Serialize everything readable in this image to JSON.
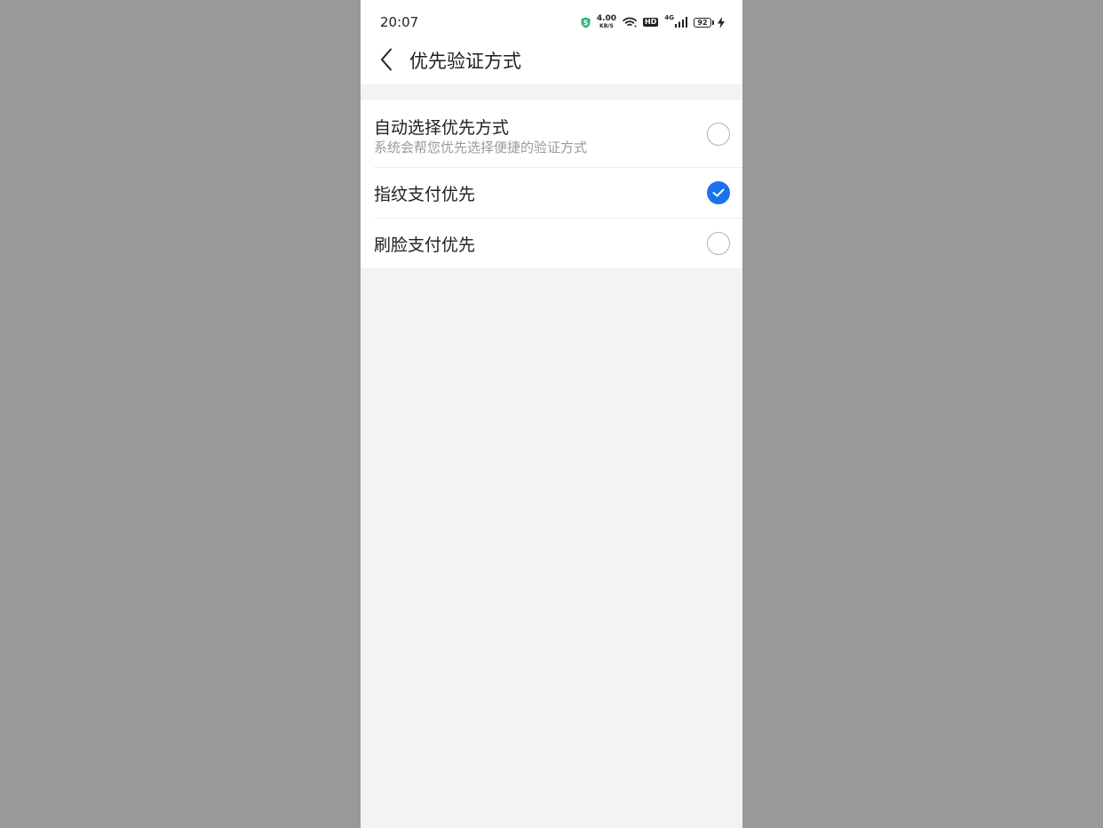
{
  "status_bar": {
    "time": "20:07",
    "net_speed_value": "4.00",
    "net_speed_unit": "KB/S",
    "hd_label": "HD",
    "network_type": "4G",
    "battery_level": "92",
    "icons": [
      "shield-icon",
      "wifi-icon",
      "hd-icon",
      "signal-icon",
      "battery-icon",
      "charging-icon"
    ]
  },
  "header": {
    "title": "优先验证方式",
    "back_icon": "back-arrow-icon"
  },
  "options": [
    {
      "title": "自动选择优先方式",
      "subtitle": "系统会帮您优先选择便捷的验证方式",
      "selected": false
    },
    {
      "title": "指纹支付优先",
      "selected": true
    },
    {
      "title": "刷脸支付优先",
      "selected": false
    }
  ],
  "colors": {
    "accent": "#1a73e8",
    "background": "#f3f3f3",
    "outer_background": "#999999",
    "shield_green": "#2bb673"
  }
}
